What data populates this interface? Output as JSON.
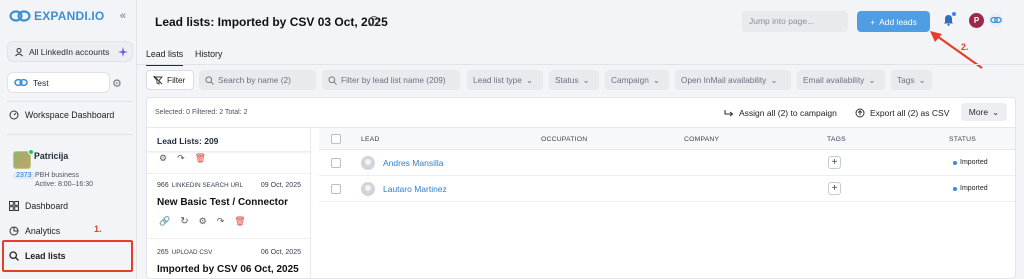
{
  "sidebar": {
    "logo_text": "EXPANDI.IO",
    "collapse_icon": "«",
    "accounts_label": "All LinkedIn accounts",
    "workspace_name": "Test",
    "workspace_dashboard": "Workspace Dashboard",
    "user": {
      "name": "Patricija",
      "badge": "2373",
      "company": "PBH business",
      "active": "Active: 8:00–16:30"
    },
    "nav": [
      {
        "label": "Dashboard",
        "icon": "grid-icon"
      },
      {
        "label": "Analytics",
        "icon": "analytics-icon"
      },
      {
        "label": "Lead lists",
        "icon": "search-icon"
      }
    ]
  },
  "annotations": {
    "one": "1.",
    "two": "2."
  },
  "header": {
    "title": "Lead lists: Imported by CSV 03 Oct, 2025",
    "jump_placeholder": "Jump into page...",
    "add_leads": "Add leads",
    "avatar_letter": "P"
  },
  "tabs": [
    "Lead lists",
    "History"
  ],
  "filters": {
    "filter_label": "Filter",
    "search_name": "Search by name (2)",
    "search_list": "Filter by lead list name (209)",
    "dropdowns": [
      "Lead list type",
      "Status",
      "Campaign",
      "Open InMail availability",
      "Email availability",
      "Tags"
    ]
  },
  "toolbar": {
    "counts": "Selected: 0   Filtered: 2   Total: 2",
    "assign": "Assign all (2) to campaign",
    "export": "Export all (2) as CSV",
    "more": "More"
  },
  "lists": {
    "heading": "Lead Lists:  209",
    "cards": [
      {
        "count": "966",
        "source": "LINKEDIN SEARCH URL",
        "date": "09 Oct, 2025",
        "title": "New Basic Test / Connector"
      },
      {
        "count": "265",
        "source": "UPLOAD CSV",
        "date": "06 Oct, 2025",
        "title": "Imported by CSV 06 Oct, 2025"
      }
    ]
  },
  "table": {
    "columns": [
      "LEAD",
      "OCCUPATION",
      "COMPANY",
      "TAGS",
      "STATUS"
    ],
    "rows": [
      {
        "name": "Andres Mansilla",
        "occupation": "",
        "company": "",
        "status": "Imported"
      },
      {
        "name": "Lautaro Martinez",
        "occupation": "",
        "company": "",
        "status": "Imported"
      }
    ],
    "tag_add": "+"
  },
  "colors": {
    "accent": "#4f9ee3",
    "annotation": "#e53e2a",
    "status_dot": "#3a8ad6"
  }
}
